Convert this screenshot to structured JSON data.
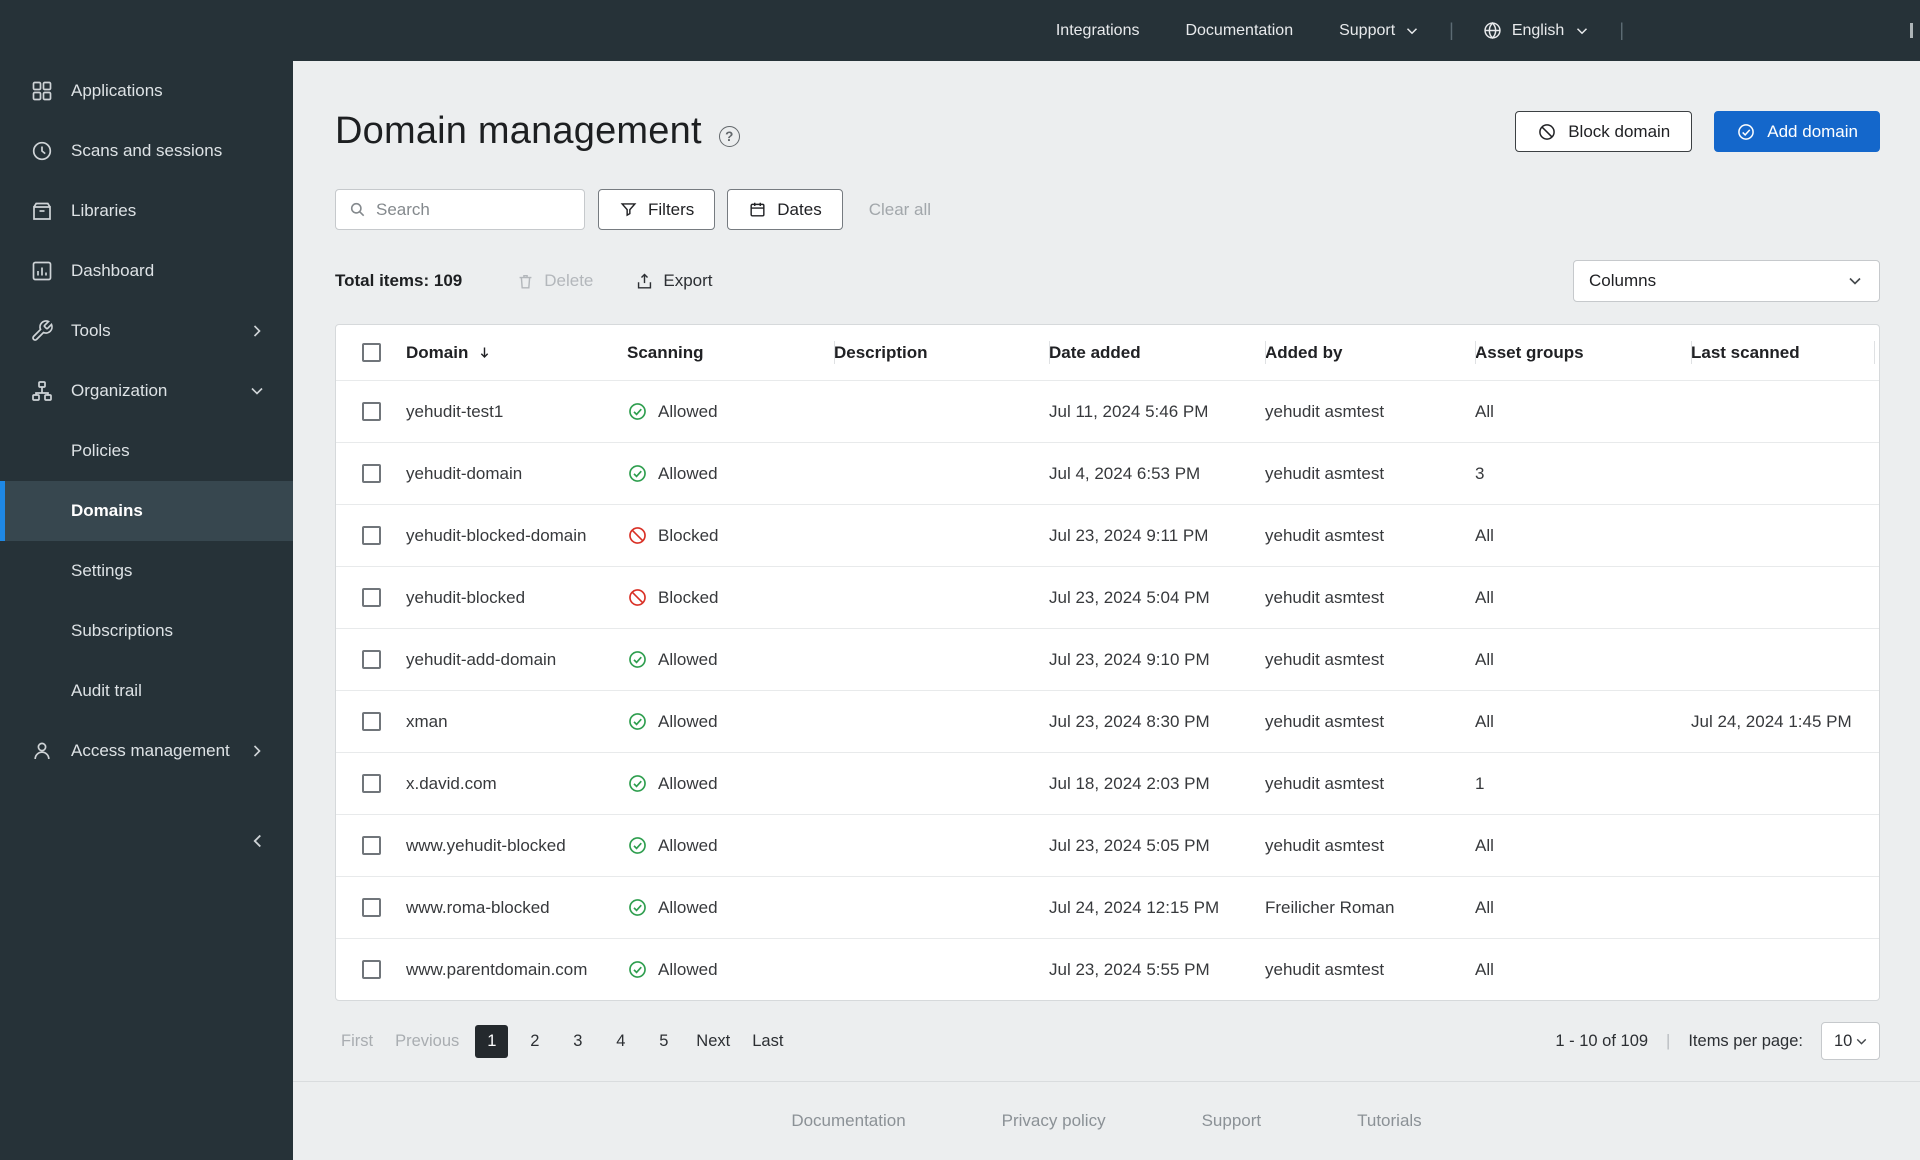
{
  "topbar": {
    "nav": [
      {
        "label": "Integrations"
      },
      {
        "label": "Documentation"
      },
      {
        "label": "Support"
      }
    ],
    "language": "English"
  },
  "sidebar": {
    "items": [
      {
        "label": "Applications"
      },
      {
        "label": "Scans and sessions"
      },
      {
        "label": "Libraries"
      },
      {
        "label": "Dashboard"
      },
      {
        "label": "Tools"
      },
      {
        "label": "Organization"
      },
      {
        "label": "Policies"
      },
      {
        "label": "Domains"
      },
      {
        "label": "Settings"
      },
      {
        "label": "Subscriptions"
      },
      {
        "label": "Audit trail"
      },
      {
        "label": "Access management"
      }
    ]
  },
  "page": {
    "title": "Domain management",
    "block_domain_label": "Block domain",
    "add_domain_label": "Add domain"
  },
  "toolbar": {
    "search_placeholder": "Search",
    "filters_label": "Filters",
    "dates_label": "Dates",
    "clear_all_label": "Clear all",
    "total_items_label": "Total items: 109",
    "delete_label": "Delete",
    "export_label": "Export",
    "columns_label": "Columns"
  },
  "table": {
    "headers": [
      "Domain",
      "Scanning",
      "Description",
      "Date added",
      "Added by",
      "Asset groups",
      "Last scanned"
    ],
    "rows": [
      {
        "domain": "yehudit-test1",
        "status": "allowed",
        "scanning": "Allowed",
        "description": "",
        "date_added": "Jul 11, 2024 5:46 PM",
        "added_by": "yehudit asmtest",
        "asset_groups": "All",
        "last_scanned": ""
      },
      {
        "domain": "yehudit-domain",
        "status": "allowed",
        "scanning": "Allowed",
        "description": "",
        "date_added": "Jul 4, 2024 6:53 PM",
        "added_by": "yehudit asmtest",
        "asset_groups": "3",
        "last_scanned": ""
      },
      {
        "domain": "yehudit-blocked-domain",
        "status": "blocked",
        "scanning": "Blocked",
        "description": "",
        "date_added": "Jul 23, 2024 9:11 PM",
        "added_by": "yehudit asmtest",
        "asset_groups": "All",
        "last_scanned": ""
      },
      {
        "domain": "yehudit-blocked",
        "status": "blocked",
        "scanning": "Blocked",
        "description": "",
        "date_added": "Jul 23, 2024 5:04 PM",
        "added_by": "yehudit asmtest",
        "asset_groups": "All",
        "last_scanned": ""
      },
      {
        "domain": "yehudit-add-domain",
        "status": "allowed",
        "scanning": "Allowed",
        "description": "",
        "date_added": "Jul 23, 2024 9:10 PM",
        "added_by": "yehudit asmtest",
        "asset_groups": "All",
        "last_scanned": ""
      },
      {
        "domain": "xman",
        "status": "allowed",
        "scanning": "Allowed",
        "description": "",
        "date_added": "Jul 23, 2024 8:30 PM",
        "added_by": "yehudit asmtest",
        "asset_groups": "All",
        "last_scanned": "Jul 24, 2024 1:45 PM"
      },
      {
        "domain": "x.david.com",
        "status": "allowed",
        "scanning": "Allowed",
        "description": "",
        "date_added": "Jul 18, 2024 2:03 PM",
        "added_by": "yehudit asmtest",
        "asset_groups": "1",
        "last_scanned": ""
      },
      {
        "domain": "www.yehudit-blocked",
        "status": "allowed",
        "scanning": "Allowed",
        "description": "",
        "date_added": "Jul 23, 2024 5:05 PM",
        "added_by": "yehudit asmtest",
        "asset_groups": "All",
        "last_scanned": ""
      },
      {
        "domain": "www.roma-blocked",
        "status": "allowed",
        "scanning": "Allowed",
        "description": "",
        "date_added": "Jul 24, 2024 12:15 PM",
        "added_by": "Freilicher Roman",
        "asset_groups": "All",
        "last_scanned": ""
      },
      {
        "domain": "www.parentdomain.com",
        "status": "allowed",
        "scanning": "Allowed",
        "description": "",
        "date_added": "Jul 23, 2024 5:55 PM",
        "added_by": "yehudit asmtest",
        "asset_groups": "All",
        "last_scanned": ""
      }
    ]
  },
  "pagination": {
    "first_label": "First",
    "previous_label": "Previous",
    "pages": [
      "1",
      "2",
      "3",
      "4",
      "5"
    ],
    "active_page": "1",
    "next_label": "Next",
    "last_label": "Last",
    "range_label": "1 - 10 of 109",
    "items_per_page_label": "Items per page:",
    "items_per_page_value": "10"
  },
  "footer": {
    "links": [
      {
        "label": "Documentation"
      },
      {
        "label": "Privacy policy"
      },
      {
        "label": "Support"
      },
      {
        "label": "Tutorials"
      }
    ]
  },
  "colors": {
    "sidebar_dark": "#263238",
    "accent_blue": "#1467cb",
    "selected_accent": "#1e88e5",
    "allowed_green": "#2e9e4e",
    "blocked_red": "#d93025"
  }
}
